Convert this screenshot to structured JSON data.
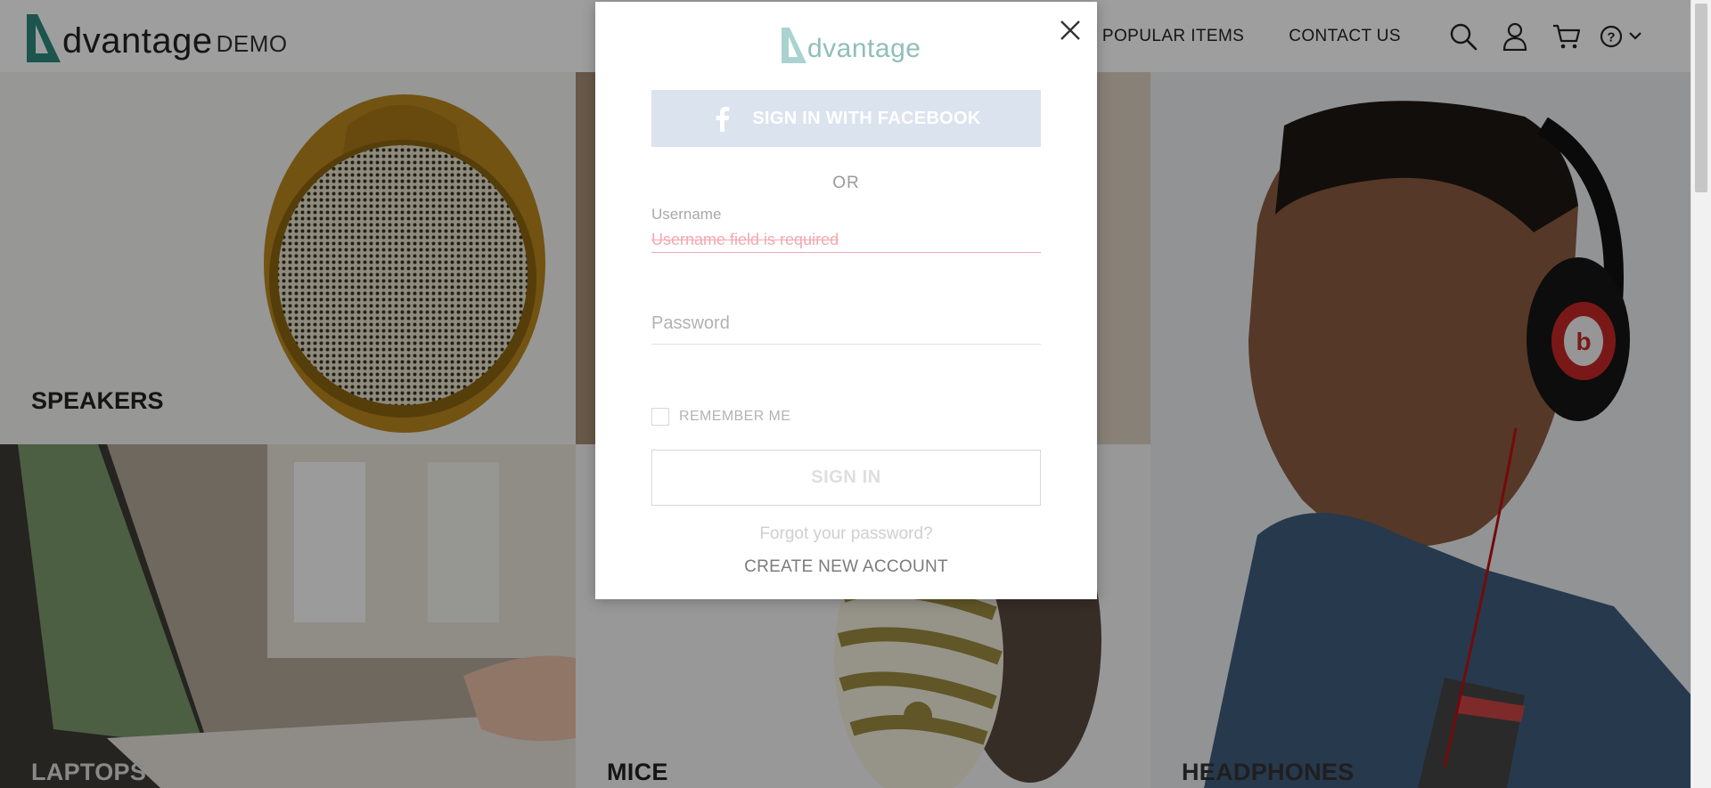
{
  "header": {
    "logo_text": "dvantage",
    "logo_suffix": "DEMO",
    "nav": {
      "popular_items": "POPULAR ITEMS",
      "contact_us": "CONTACT US"
    },
    "icons": [
      "search-icon",
      "user-icon",
      "cart-icon",
      "help-icon",
      "chevron-down-icon"
    ]
  },
  "categories": {
    "speakers": "SPEAKERS",
    "laptops": "LAPTOPS",
    "mice": "MICE",
    "headphones": "HEADPHONES"
  },
  "login_modal": {
    "logo_text": "dvantage",
    "facebook_button": "SIGN IN WITH FACEBOOK",
    "or_text": "OR",
    "username_label": "Username",
    "username_error": "Username field is required",
    "password_placeholder": "Password",
    "remember_me": "REMEMBER ME",
    "sign_in_button": "SIGN IN",
    "forgot_password": "Forgot your password?",
    "create_account": "CREATE NEW ACCOUNT"
  },
  "colors": {
    "brand_accent": "#2d8a7d",
    "error": "#f2a8b2",
    "facebook_button_bg": "#dbe3ef"
  }
}
